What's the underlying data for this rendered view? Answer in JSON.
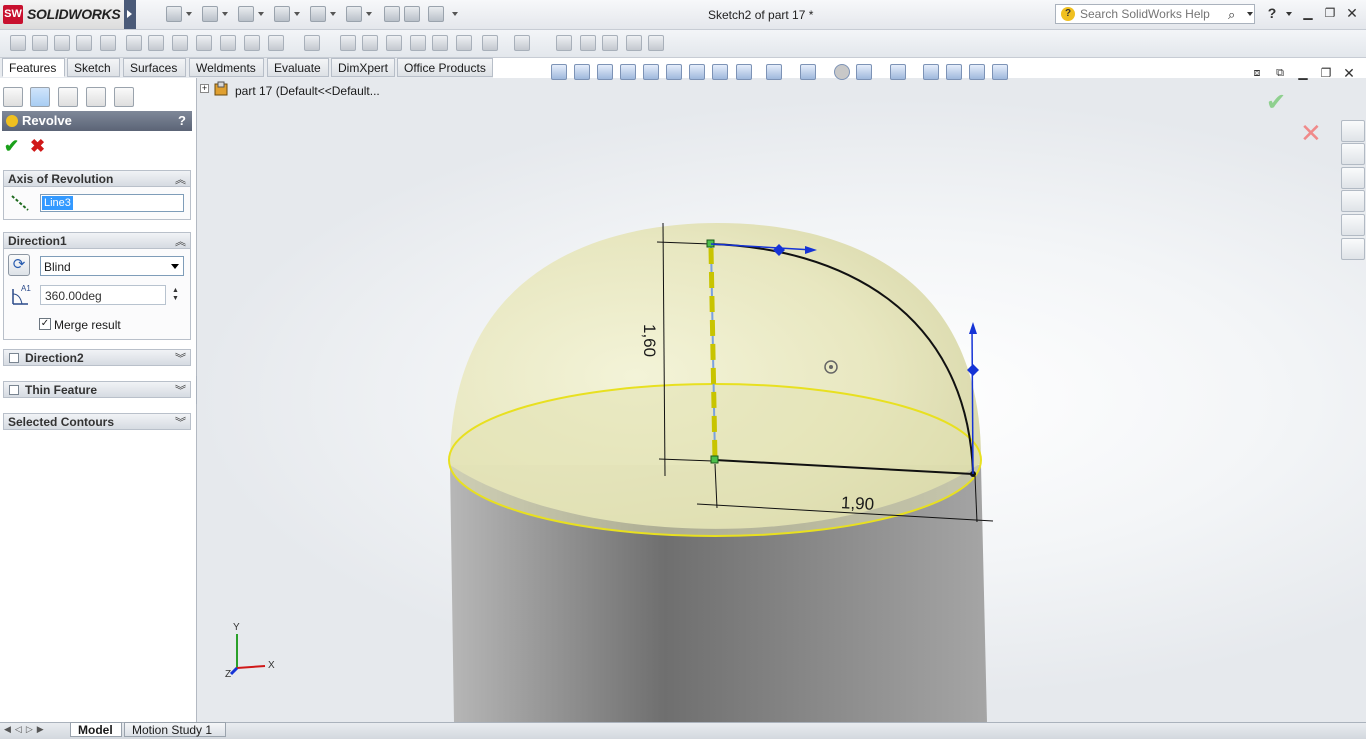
{
  "app": {
    "logo_text": "SOLIDWORKS",
    "logo_badge": "SW",
    "doc_title": "Sketch2 of part 17 *"
  },
  "search": {
    "placeholder": "Search SolidWorks Help"
  },
  "window_controls": {
    "help": "?"
  },
  "tabs": [
    {
      "label": "Features",
      "active": true
    },
    {
      "label": "Sketch"
    },
    {
      "label": "Surfaces"
    },
    {
      "label": "Weldments"
    },
    {
      "label": "Evaluate"
    },
    {
      "label": "DimXpert"
    },
    {
      "label": "Office Products"
    }
  ],
  "feature_tree": {
    "root_label": "part 17  (Default<<Default..."
  },
  "property_manager": {
    "title": "Revolve",
    "help": "?",
    "axis_group": {
      "title": "Axis of Revolution",
      "axis_value": "Line3"
    },
    "direction1": {
      "title": "Direction1",
      "end_condition": "Blind",
      "angle": "360.00deg",
      "angle_symbol": "A1",
      "merge_label": "Merge result",
      "merge_checked": true
    },
    "direction2": {
      "title": "Direction2"
    },
    "thin_feature": {
      "title": "Thin Feature"
    },
    "selected_contours": {
      "title": "Selected Contours"
    }
  },
  "sketch": {
    "dim_vertical": "1,60",
    "dim_horizontal": "1,90"
  },
  "triad": {
    "x": "X",
    "y": "Y",
    "z": "Z"
  },
  "bottom_tabs": [
    {
      "label": "Model",
      "active": true
    },
    {
      "label": "Motion Study 1"
    }
  ],
  "colors": {
    "accent": "#3399ff",
    "edge_highlight": "#e8e020",
    "dome": "#e9e8bf",
    "cylinder": "#8d8d8d",
    "sketch_blue": "#1533d6"
  }
}
